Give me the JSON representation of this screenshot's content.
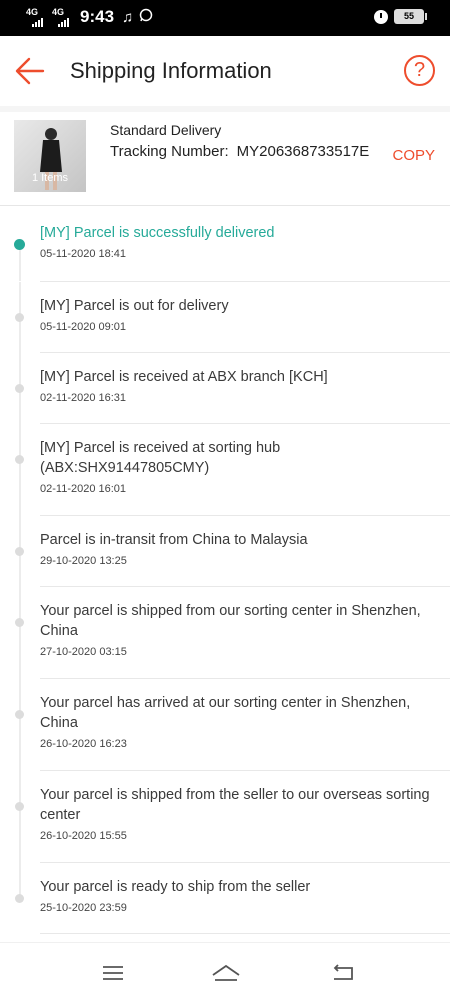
{
  "status_bar": {
    "network1": "4G",
    "network2": "4G",
    "time": "9:43",
    "icons": [
      "music-note-icon",
      "whatsapp-icon",
      "alarm-icon"
    ],
    "battery": "55"
  },
  "header": {
    "title": "Shipping Information",
    "back_icon": "arrow-left-icon",
    "help_label": "?"
  },
  "shipment": {
    "items_count": "1 Items",
    "service": "Standard Delivery",
    "tracking_label": "Tracking Number:",
    "tracking_number": "MY206368733517E",
    "copy_label": "COPY"
  },
  "events": [
    {
      "text": "[MY] Parcel is successfully delivered",
      "time": "05-11-2020 18:41",
      "active": true
    },
    {
      "text": "[MY] Parcel is out for delivery",
      "time": "05-11-2020 09:01"
    },
    {
      "text": "[MY] Parcel is received at ABX branch [KCH]",
      "time": "02-11-2020 16:31"
    },
    {
      "text": "[MY] Parcel is received at sorting hub (ABX:SHX91447805CMY)",
      "time": "02-11-2020 16:01"
    },
    {
      "text": "Parcel is in-transit from China to Malaysia",
      "time": "29-10-2020 13:25"
    },
    {
      "text": "Your parcel is shipped from our sorting center in Shenzhen, China",
      "time": "27-10-2020 03:15"
    },
    {
      "text": "Your parcel has arrived at our sorting center in Shenzhen, China",
      "time": "26-10-2020 16:23"
    },
    {
      "text": "Your parcel is shipped from the seller to our overseas sorting center",
      "time": "26-10-2020 15:55"
    },
    {
      "text": "Your parcel is ready to ship from the seller",
      "time": "25-10-2020 23:59"
    }
  ],
  "nav": [
    "menu-icon",
    "home-icon",
    "back-icon"
  ],
  "colors": {
    "accent": "#ee4d2d",
    "delivered": "#26aa99"
  }
}
